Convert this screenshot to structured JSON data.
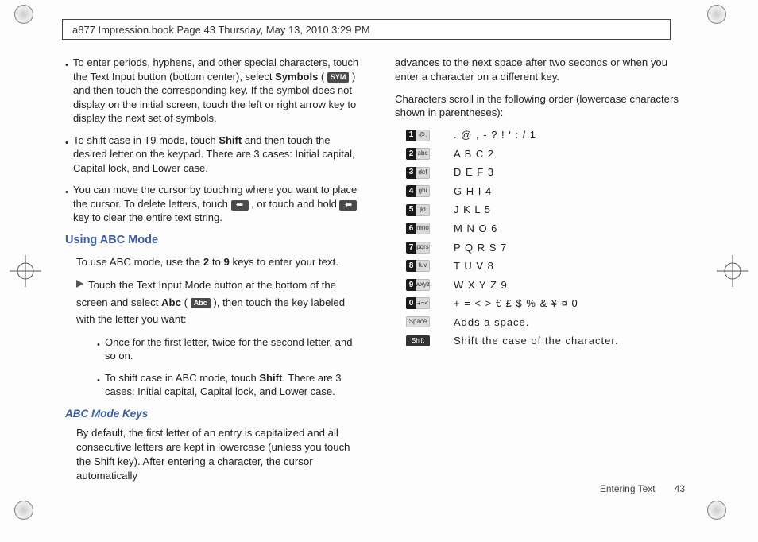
{
  "header": {
    "text": "a877 Impression.book  Page 43  Thursday, May 13, 2010  3:29 PM"
  },
  "col1": {
    "b1": "To enter periods, hyphens, and other special characters, touch the Text Input button (bottom center), select ",
    "b1b": "Symbols",
    "b1c": " ( ",
    "b1sym": "SYM",
    "b1d": " ) and then touch the corresponding key. If the symbol does not display on the initial screen, touch the left or right arrow key to display the next set of symbols.",
    "b2a": "To shift case in T9 mode, touch ",
    "b2b": "Shift",
    "b2c": " and then touch the desired letter on the keypad. There are 3 cases: Initial capital, Capital lock, and Lower case.",
    "b3a": "You can move the cursor by touching where you want to place the cursor. To delete letters, touch  ",
    "b3b": " , or touch and hold  ",
    "b3c": "  key to clear the entire text string.",
    "h1": "Using ABC Mode",
    "p1a": "To use ABC mode, use the ",
    "p1b": "2",
    "p1c": " to ",
    "p1d": "9",
    "p1e": " keys to enter your text.",
    "p2a": "Touch the Text Input Mode button at the bottom of the screen and select ",
    "p2b": "Abc",
    "p2c": " ( ",
    "p2abc": "Abc",
    "p2d": " ), then touch the key labeled with the letter you want:",
    "sb1": "Once for the first letter, twice for the second letter, and so on.",
    "sb2a": "To shift case in ABC mode, touch ",
    "sb2b": "Shift",
    "sb2c": ". There are 3 cases: Initial capital, Capital lock, and Lower case.",
    "h2": "ABC Mode Keys",
    "p3": "By default, the first letter of an entry is capitalized and all consecutive letters are kept in lowercase (unless you touch the Shift key). After entering a character, the cursor automatically"
  },
  "col2": {
    "p1": "advances to the next space after two seconds or when you enter a character on a different key.",
    "p2": "Characters scroll in the following order (lowercase characters shown in parentheses):",
    "rows": [
      {
        "num": "1",
        "sub": "@,",
        "chars": ". @ , - ? ! ' : / 1"
      },
      {
        "num": "2",
        "sub": "abc",
        "chars": "A B C 2"
      },
      {
        "num": "3",
        "sub": "def",
        "chars": "D E F 3"
      },
      {
        "num": "4",
        "sub": "ghi",
        "chars": "G H I 4"
      },
      {
        "num": "5",
        "sub": "jkl",
        "chars": "J K L 5"
      },
      {
        "num": "6",
        "sub": "mno",
        "chars": "M N O 6"
      },
      {
        "num": "7",
        "sub": "pqrs",
        "chars": "P Q R S 7"
      },
      {
        "num": "8",
        "sub": "tuv",
        "chars": "T U V 8"
      },
      {
        "num": "9",
        "sub": "wxyz",
        "chars": "W X Y Z 9"
      },
      {
        "num": "0",
        "sub": "+=<",
        "chars": "+ = < > € £ $ % & ¥ ¤ 0"
      }
    ],
    "space_label": "Space",
    "space_text": "Adds a space.",
    "shift_label": "Shift",
    "shift_text": "Shift the case of the character."
  },
  "footer": {
    "section": "Entering Text",
    "page": "43"
  },
  "icons": {
    "arrow_left": "⬅"
  }
}
